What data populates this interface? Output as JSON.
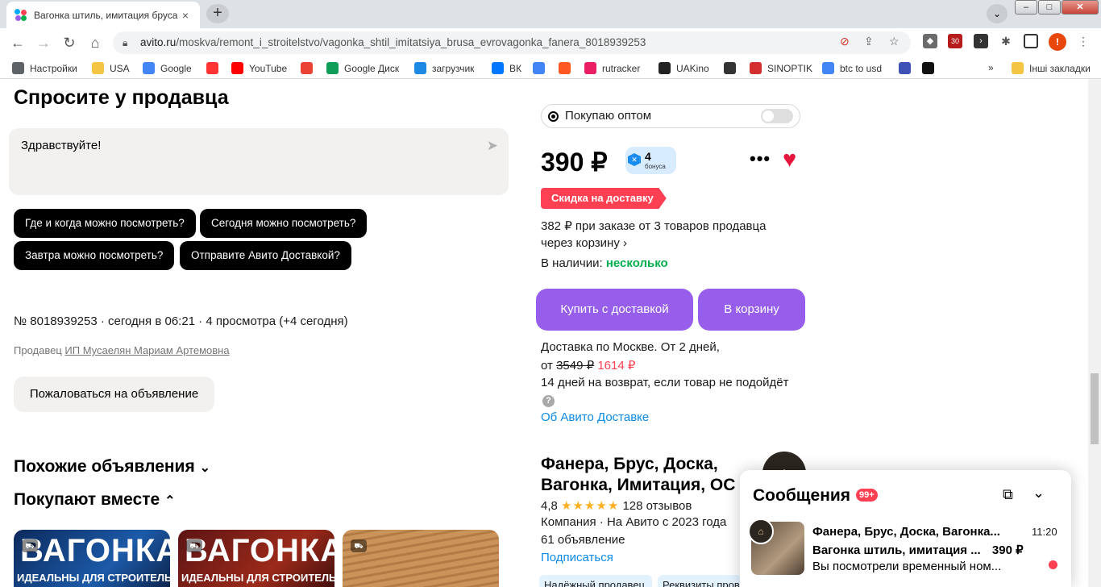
{
  "browser": {
    "tab_title": "Вагонка штиль, имитация бруса",
    "tab_close": "×",
    "new_tab": "+",
    "win_min": "–",
    "win_max": "□",
    "win_close": "✕",
    "url_host": "avito.ru",
    "url_path": "/moskva/remont_i_stroitelstvo/vagonka_shtil_imitatsiya_brusa_evrovagonka_fanera_8018939253",
    "ext_badge": "30",
    "profile_letter": "!",
    "bookmarks": [
      {
        "label": "Настройки",
        "icon": "gear-icon",
        "color": "#5f6368"
      },
      {
        "label": "USA",
        "icon": "folder-icon",
        "color": "#f4c542"
      },
      {
        "label": "Google",
        "icon": "google-icon",
        "color": "#4285f4"
      },
      {
        "label": "",
        "icon": "yandex-icon",
        "color": "#ff3333"
      },
      {
        "label": "YouTube",
        "icon": "youtube-icon",
        "color": "#ff0000"
      },
      {
        "label": "",
        "icon": "gmail-icon",
        "color": "#ea4335"
      },
      {
        "label": "Google Диск",
        "icon": "drive-icon",
        "color": "#0f9d58"
      },
      {
        "label": "загрузчик",
        "icon": "loop-icon",
        "color": "#1e88e5"
      },
      {
        "label": "ВК",
        "icon": "vk-icon",
        "color": "#0077ff"
      },
      {
        "label": "",
        "icon": "translate-icon",
        "color": "#4285f4"
      },
      {
        "label": "",
        "icon": "f-icon",
        "color": "#ff5722"
      },
      {
        "label": "rutracker",
        "icon": "rutracker-icon",
        "color": "#e91e63"
      },
      {
        "label": "UAKino",
        "icon": "uakino-icon",
        "color": "#222222"
      },
      {
        "label": "",
        "icon": "chess-icon",
        "color": "#333333"
      },
      {
        "label": "SINOPTIK",
        "icon": "thermometer-icon",
        "color": "#d32f2f"
      },
      {
        "label": "btc to usd",
        "icon": "google-icon",
        "color": "#4285f4"
      },
      {
        "label": "",
        "icon": "arrow-icon",
        "color": "#3f51b5"
      },
      {
        "label": "",
        "icon": "bc-icon",
        "color": "#111111"
      }
    ],
    "more_bookmarks": "»",
    "other_bookmarks": "Інші закладки"
  },
  "ask": {
    "title": "Спросите у продавца",
    "message_value": "Здравствуйте!",
    "quick_questions": [
      "Где и когда можно посмотреть?",
      "Сегодня можно посмотреть?",
      "Завтра можно посмотреть?",
      "Отправите Авито Доставкой?"
    ]
  },
  "listing": {
    "meta": "№ 8018939253 · сегодня в 06:21 · 4 просмотра (+4 сегодня)",
    "seller_prefix": "Продавец",
    "seller_name": "ИП Мусаелян Мариам Артемовна",
    "complain": "Пожаловаться на объявление",
    "similar": "Похожие объявления",
    "similar_arrow": "⌄",
    "bought_together": "Покупают вместе",
    "bought_arrow": "⌃",
    "cards": [
      {
        "big": "ВАГОНКА",
        "small": "ИДЕАЛЬНЫ ДЛЯ СТРОИТЕЛЬСТВА"
      },
      {
        "big": "ВАГОНКА",
        "small": "ИДЕАЛЬНЫ ДЛЯ СТРОИТЕЛЬСТВА"
      },
      {
        "big": "",
        "small": ""
      }
    ]
  },
  "buy": {
    "wholesale": "Покупаю оптом",
    "price": "390 ₽",
    "bonus_count": "4",
    "bonus_label": "бонуса",
    "more": "•••",
    "heart": "♥",
    "discount_badge": "Скидка на доставку",
    "bulk_line1": "382 ₽ при заказе от 3 товаров продавца",
    "bulk_line2": "через корзину ›",
    "stock_label": "В наличии:",
    "stock_value": "несколько",
    "buy_delivery": "Купить с доставкой",
    "to_cart": "В корзину",
    "delivery_line": "Доставка по Москве. От 2 дней,",
    "from": "от",
    "old_price": "3549 ₽",
    "new_price": "1614 ₽",
    "return_line": "14 дней на возврат, если товар не подойдёт",
    "help": "?",
    "about_delivery": "Об Авито Доставке"
  },
  "shop": {
    "name": "Фанера, Брус, Доска, Вагонка, Имитация, ОС",
    "rating": "4,8",
    "stars": "★★★★★",
    "reviews": "128 отзывов",
    "since": "Компания · На Авито с 2023 года",
    "count": "61 объявление",
    "subscribe": "Подписаться",
    "tags": [
      "Надёжный продавец",
      "Реквизиты проверены"
    ]
  },
  "messages": {
    "title": "Сообщения",
    "count": "99+",
    "item_title": "Фанера, Брус, Доска, Вагонка...",
    "item_subtitle": "Вагонка штиль, имитация ...",
    "item_price": "390 ₽",
    "item_preview": "Вы посмотрели временный ном...",
    "item_time": "11:20"
  },
  "colors": {
    "accent_purple": "#965eeb",
    "discount_red": "#ff4053",
    "stock_green": "#04b04e",
    "link_blue": "#0a8ae5"
  }
}
